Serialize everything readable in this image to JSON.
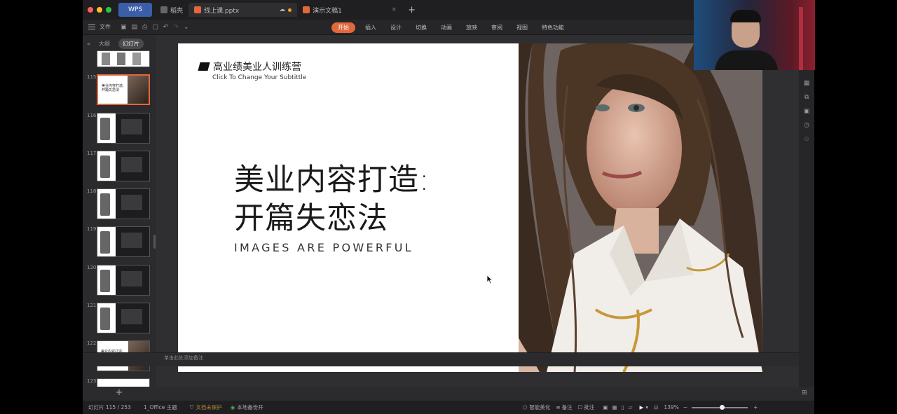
{
  "app": {
    "name": "WPS"
  },
  "tabs": [
    {
      "label": "稻壳"
    },
    {
      "label": "线上课.pptx"
    },
    {
      "label": "演示文稿1"
    }
  ],
  "ribbon": {
    "file_menu": "文件",
    "tabs": [
      "开始",
      "插入",
      "设计",
      "切换",
      "动画",
      "放映",
      "审阅",
      "视图",
      "特色功能"
    ],
    "active_tab": "开始"
  },
  "left_panel": {
    "outline_label": "大纲",
    "slides_label": "幻灯片",
    "thumbnails": [
      {
        "num": "115",
        "title": "美业内容打造:开篇失恋法",
        "selected": true
      },
      {
        "num": "116",
        "title": ""
      },
      {
        "num": "117",
        "title": ""
      },
      {
        "num": "118",
        "title": ""
      },
      {
        "num": "119",
        "title": ""
      },
      {
        "num": "120",
        "title": ""
      },
      {
        "num": "121",
        "title": ""
      },
      {
        "num": "122",
        "title": "美业内容打造:开篇失恋法"
      },
      {
        "num": "123",
        "title": ""
      }
    ]
  },
  "slide": {
    "brand": "高业绩美业人训练营",
    "subtitle": "Click To Change Your Subtittle",
    "heading_line1": "美业内容打造:",
    "heading_line2": "开篇失恋法",
    "tagline": "IMAGES ARE POWERFUL"
  },
  "notes": {
    "placeholder": "单击此处添加备注"
  },
  "status": {
    "slide_counter": "幻灯片 115 / 253",
    "theme": "1_Office 主题",
    "doc_protect": "文档未保护",
    "backup": "本地备份开",
    "smart_beautify": "智能美化",
    "notes_toggle": "备注",
    "comments_toggle": "批注",
    "zoom": "139%"
  },
  "colors": {
    "accent": "#e2683c",
    "wps_tab": "#3b5ea8",
    "window_bg": "#2b2b2e"
  }
}
